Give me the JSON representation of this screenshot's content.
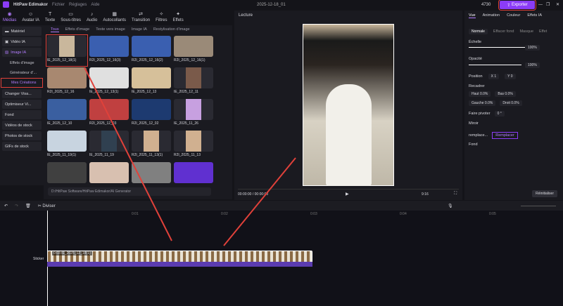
{
  "app": {
    "title": "HitPaw Edimakor",
    "menus": [
      "Fichier",
      "Réglages",
      "Aide"
    ],
    "project": "2025-12-18_01",
    "credits": "4730",
    "export": "Exporter"
  },
  "toolbar": [
    "Médias",
    "Avatar IA",
    "Texte",
    "Sous-titres",
    "Audio",
    "Autocollants",
    "Transition",
    "Filtres",
    "Effets"
  ],
  "sidebar": {
    "items": [
      "Matériel",
      "Vidéo IA",
      "Image IA"
    ],
    "sub": [
      "Effets d'image",
      "Générateur d'...",
      "Mes Créations"
    ],
    "more": [
      "Changer Visa...",
      "Optimiseur Vi...",
      "Fond",
      "Vidéos de stock",
      "Photos de stock",
      "GIFs de stock"
    ]
  },
  "media": {
    "tabs": [
      "Tous",
      "Effets d'image",
      "Texte vers image",
      "Image IA",
      "Restylisation d'image"
    ],
    "items": [
      "IE_2025_12_18(1)",
      "R2I_2025_12_16(3)",
      "R2I_2025_12_16(2)",
      "R2I_2025_12_16(1)",
      "R2I_2025_12_16",
      "IE_2025_12_13(1)",
      "IE_2025_12_13",
      "IE_2025_12_11",
      "IE_2025_12_10",
      "R2I_2025_12_03",
      "R2I_2025_12_02",
      "IE_2025_11_26",
      "IE_2025_11_19(1)",
      "IE_2025_11_19",
      "R2I_2025_11_13(1)",
      "R2I_2025_11_13",
      "",
      "",
      "",
      ""
    ],
    "path": "D:/HitPaw Software/HitPaw Edimakor/AI Generator"
  },
  "preview": {
    "title": "Lecture",
    "time": "00:00:00 / 00:00:00",
    "ratio": "9:16"
  },
  "right": {
    "tabs": [
      "Vue",
      "Animation",
      "Couleur",
      "Effets IA"
    ],
    "modes": [
      "Normale",
      "Effacer fond",
      "Masque",
      "Effet"
    ],
    "scale_label": "Échelle",
    "scale": "100%",
    "scale_value": 100,
    "opacity_label": "Opacité",
    "opacity": "100%",
    "opacity_value": 100,
    "position": "Position",
    "x": "1",
    "y": "0",
    "crop": "Recadrer",
    "haut": "Haut",
    "bas": "Bas",
    "gauche": "Gauche",
    "droit": "Droit",
    "zero": "0.0%",
    "rotate": "Faire pivoter",
    "rot": "0 °",
    "mirror": "Miroir",
    "replace_label": "remplace...",
    "replace": "Remplacer",
    "bg": "Fond",
    "reset": "Réinitialiser"
  },
  "timeline": {
    "split": "Diviser",
    "ticks": [
      "0:01",
      "0:02",
      "0:03",
      "0:04",
      "0:05"
    ],
    "track": "Sticker",
    "clip": "0:03 IE_2025_12_18(1)"
  }
}
